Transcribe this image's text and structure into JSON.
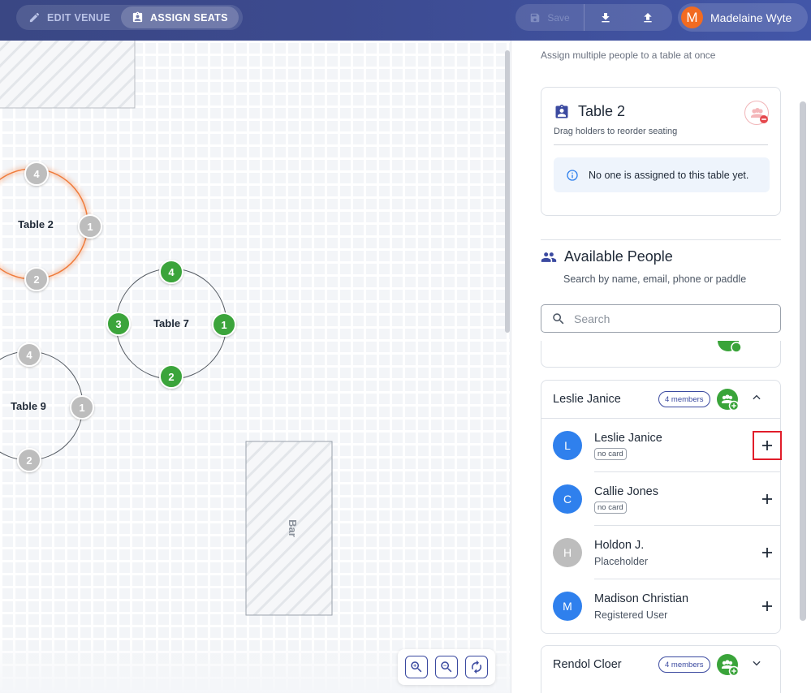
{
  "topbar": {
    "mode_edit_label": "EDIT VENUE",
    "mode_assign_label": "ASSIGN SEATS",
    "save_label": "Save",
    "user_initial": "M",
    "user_name": "Madelaine Wyte",
    "colors": {
      "bar": "#3c4a8f",
      "avatar": "#f26b21"
    }
  },
  "canvas": {
    "tables": [
      {
        "name": "Table 2",
        "selected": true,
        "seats": [
          "4",
          "1",
          "2"
        ]
      },
      {
        "name": "Table 7",
        "selected": false,
        "seats": [
          "4",
          "1",
          "2",
          "3"
        ]
      },
      {
        "name": "Table 9",
        "selected": false,
        "seats": [
          "4",
          "1",
          "2"
        ]
      }
    ],
    "bar_label": "Bar",
    "colors": {
      "selected_ring": "#f07c3c",
      "seat_assigned": "#3aa43a",
      "seat_empty": "#bdbdbd"
    }
  },
  "panel": {
    "assign_hint": "Assign multiple people to a table at once",
    "table_card": {
      "title": "Table 2",
      "subtitle": "Drag holders to reorder seating",
      "empty_message": "No one is assigned to this table yet."
    },
    "available": {
      "title": "Available People",
      "subtitle": "Search by name, email, phone or paddle",
      "search_placeholder": "Search",
      "search_value": ""
    },
    "groups": [
      {
        "name": "Leslie Janice",
        "members_badge": "4 members",
        "expanded": true,
        "people": [
          {
            "initial": "L",
            "name": "Leslie Janice",
            "tag": "no card",
            "avatar_color": "#2f80ed"
          },
          {
            "initial": "C",
            "name": "Callie Jones",
            "tag": "no card",
            "avatar_color": "#2f80ed"
          },
          {
            "initial": "H",
            "name": "Holdon J.",
            "role": "Placeholder",
            "avatar_color": "#bdbdbd"
          },
          {
            "initial": "M",
            "name": "Madison Christian",
            "role": "Registered User",
            "avatar_color": "#2f80ed"
          }
        ]
      },
      {
        "name": "Rendol Cloer",
        "members_badge": "4 members",
        "expanded": false
      }
    ]
  }
}
